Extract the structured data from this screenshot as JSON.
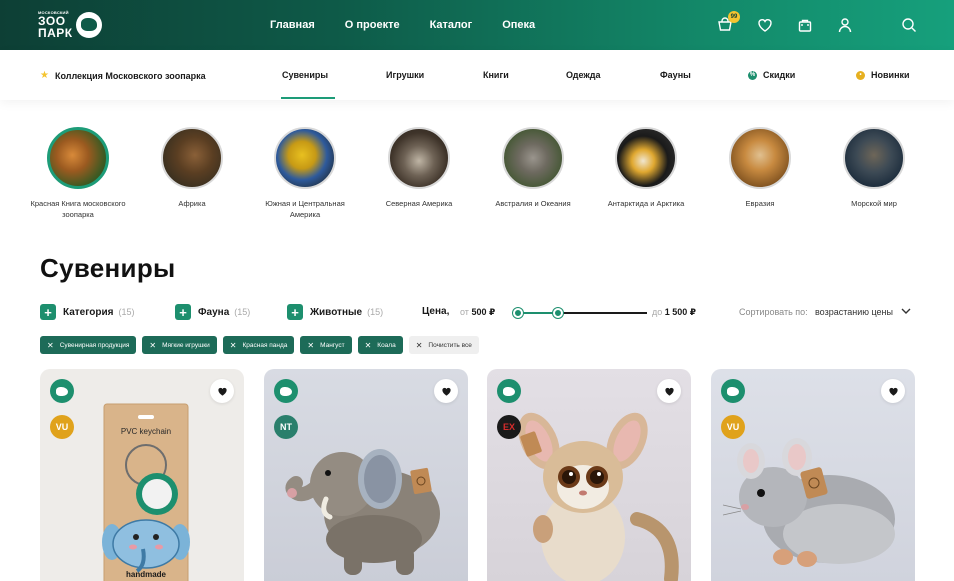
{
  "brand": {
    "logo_small": "МОСКОВСКИЙ",
    "logo_big_1": "ЗОО",
    "logo_big_2": "ПАРК"
  },
  "nav": [
    "Главная",
    "О проекте",
    "Каталог",
    "Опека"
  ],
  "header_icons": {
    "cart_badge": "99",
    "icons": [
      "cart-icon",
      "heart-icon",
      "basket-icon",
      "user-icon",
      "search-icon"
    ]
  },
  "subnav": {
    "collection": "Коллекция Московского зоопарка",
    "souvenirs": "Сувениры",
    "toys": "Игрушки",
    "books": "Книги",
    "clothes": "Одежда",
    "faunas": "Фауны",
    "discounts": "Скидки",
    "new": "Новинки"
  },
  "regions": [
    {
      "label": "Красная Книга московского зоопарка"
    },
    {
      "label": "Африка"
    },
    {
      "label": "Южная и Центральная Америка"
    },
    {
      "label": "Северная Америка"
    },
    {
      "label": "Австралия и Океания"
    },
    {
      "label": "Антарктида и Арктика"
    },
    {
      "label": "Евразия"
    },
    {
      "label": "Морской мир"
    }
  ],
  "page_title": "Сувениры",
  "filters": {
    "category": "Категория",
    "category_count": "(15)",
    "fauna": "Фауна",
    "fauna_count": "(15)",
    "animals": "Животные",
    "animals_count": "(15)",
    "price_label": "Цена,",
    "price_from_prefix": "от",
    "price_from": "500 ₽",
    "price_to_prefix": "до",
    "price_to": "1 500 ₽",
    "sort_label": "Сортировать по:",
    "sort_value": "возрастанию цены"
  },
  "chips": [
    "Сувенирная продукция",
    "Мягкие игрушки",
    "Красная панда",
    "Мангуст",
    "Коала"
  ],
  "clear_all": "Почистить все",
  "cards": [
    {
      "status": "VU",
      "packaging_text": "PVC keychain",
      "packaging_bottom": "handmade",
      "medallion": "МОСКОВСКИЙ ЗООПАРК"
    },
    {
      "status": "NT"
    },
    {
      "status": "EX"
    },
    {
      "status": "VU"
    }
  ],
  "colors": {
    "brand_dark": "#0d3f35",
    "brand_green": "#1d8f6e",
    "vu": "#e0a21b",
    "nt": "#2a7f6c",
    "ex": "#1a1a1a",
    "ex_text": "#d62c2c"
  }
}
